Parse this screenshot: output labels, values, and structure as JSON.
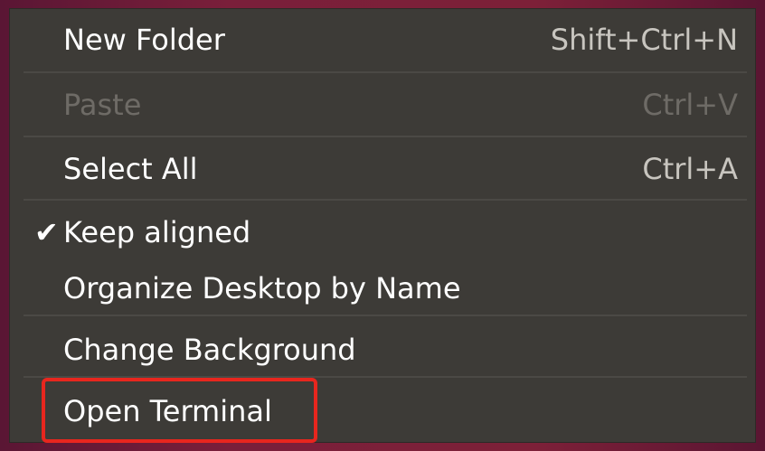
{
  "menu": {
    "items": [
      {
        "label": "New Folder",
        "accel": "Shift+Ctrl+N",
        "check": "",
        "enabled": true
      },
      {
        "label": "Paste",
        "accel": "Ctrl+V",
        "check": "",
        "enabled": false
      },
      {
        "label": "Select All",
        "accel": "Ctrl+A",
        "check": "",
        "enabled": true
      },
      {
        "label": "Keep aligned",
        "accel": "",
        "check": "✔",
        "enabled": true
      },
      {
        "label": "Organize Desktop by Name",
        "accel": "",
        "check": "",
        "enabled": true
      },
      {
        "label": "Change Background",
        "accel": "",
        "check": "",
        "enabled": true
      },
      {
        "label": "Open Terminal",
        "accel": "",
        "check": "",
        "enabled": true
      }
    ]
  },
  "annotation": {
    "highlight_color": "#e8261e",
    "highlighted_item": "Open Terminal"
  },
  "colors": {
    "menu_background": "#3d3b37",
    "desktop_background": "#7a1f3a",
    "text": "#ffffff",
    "disabled_text": "#6e6b66"
  }
}
